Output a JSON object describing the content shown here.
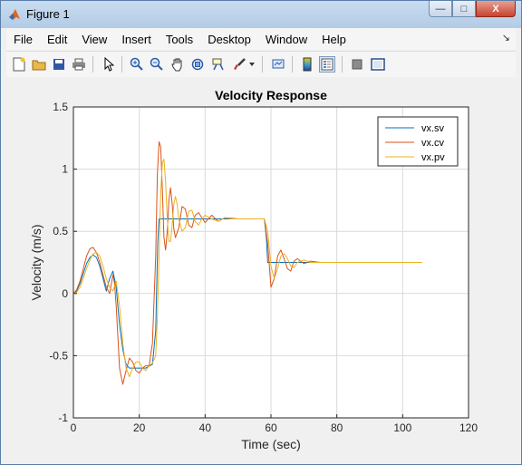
{
  "window": {
    "title": "Figure 1",
    "controls": {
      "minimize": "—",
      "maximize": "□",
      "close": "X"
    }
  },
  "menubar": {
    "items": [
      "File",
      "Edit",
      "View",
      "Insert",
      "Tools",
      "Desktop",
      "Window",
      "Help"
    ]
  },
  "toolbar": {
    "icons": [
      "new-figure-icon",
      "open-file-icon",
      "save-icon",
      "print-icon",
      "pointer-icon",
      "zoom-in-icon",
      "zoom-out-icon",
      "pan-hand-icon",
      "rotate-3d-icon",
      "data-cursor-icon",
      "brush-icon",
      "brush-dropdown-icon",
      "link-plot-icon",
      "insert-colorbar-icon",
      "insert-legend-icon",
      "hide-plot-tools-icon",
      "show-plot-tools-icon"
    ]
  },
  "colors": {
    "sv": "#0072bd",
    "cv": "#d95319",
    "pv": "#edb120",
    "grid": "#d9d9d9"
  },
  "chart_data": {
    "type": "line",
    "title": "Velocity Response",
    "xlabel": "Time (sec)",
    "ylabel": "Velocity (m/s)",
    "xlim": [
      0,
      120
    ],
    "ylim": [
      -1,
      1.5
    ],
    "xticks": [
      0,
      20,
      40,
      60,
      80,
      100,
      120
    ],
    "yticks": [
      -1,
      -0.5,
      0,
      0.5,
      1,
      1.5
    ],
    "grid": true,
    "legend_position": "top-right",
    "series": [
      {
        "name": "vx.sv",
        "color": "#0072bd",
        "x": [
          0,
          1,
          2,
          3,
          4,
          5,
          6,
          7,
          8,
          9,
          10,
          11,
          12,
          13,
          14,
          15,
          16,
          17,
          18,
          20,
          22,
          24,
          25,
          25.6,
          26,
          30,
          40,
          50,
          58,
          58.6,
          59,
          60,
          70,
          80,
          90,
          100
        ],
        "y": [
          0,
          0.02,
          0.08,
          0.16,
          0.24,
          0.29,
          0.31,
          0.29,
          0.22,
          0.12,
          0.02,
          0.12,
          0.18,
          0.05,
          -0.25,
          -0.45,
          -0.57,
          -0.6,
          -0.6,
          -0.6,
          -0.6,
          -0.57,
          -0.3,
          0.4,
          0.6,
          0.6,
          0.6,
          0.6,
          0.6,
          0.45,
          0.25,
          0.25,
          0.25,
          0.25,
          0.25,
          0.25
        ]
      },
      {
        "name": "vx.cv",
        "color": "#d95319",
        "x": [
          0,
          1,
          2,
          3,
          4,
          5,
          6,
          7,
          8,
          9,
          10,
          11,
          12,
          12.5,
          13,
          13.5,
          14,
          15,
          16,
          17,
          18,
          19,
          20,
          21,
          22,
          23,
          24,
          25,
          25.5,
          26,
          26.5,
          27,
          27.5,
          28,
          28.5,
          29,
          29.5,
          30,
          30.5,
          31,
          32,
          33,
          34,
          35,
          36,
          37,
          38,
          40,
          42,
          44,
          46,
          50,
          55,
          58,
          59,
          60,
          61,
          62,
          63,
          64,
          65,
          66,
          67,
          68,
          70,
          72,
          75,
          80,
          88
        ],
        "y": [
          0,
          0.03,
          0.1,
          0.2,
          0.3,
          0.36,
          0.37,
          0.33,
          0.25,
          0.15,
          0.05,
          0.0,
          0.15,
          0.08,
          -0.1,
          -0.35,
          -0.6,
          -0.73,
          -0.62,
          -0.52,
          -0.55,
          -0.62,
          -0.64,
          -0.6,
          -0.58,
          -0.58,
          -0.4,
          0.3,
          0.95,
          1.22,
          1.18,
          0.85,
          0.45,
          0.35,
          0.5,
          0.75,
          0.85,
          0.72,
          0.52,
          0.45,
          0.53,
          0.7,
          0.68,
          0.55,
          0.53,
          0.63,
          0.65,
          0.57,
          0.63,
          0.58,
          0.61,
          0.6,
          0.6,
          0.6,
          0.4,
          0.05,
          0.12,
          0.3,
          0.35,
          0.28,
          0.2,
          0.18,
          0.26,
          0.28,
          0.24,
          0.26,
          0.25,
          0.25,
          0.25
        ]
      },
      {
        "name": "vx.pv",
        "color": "#edb120",
        "x": [
          0,
          1,
          2,
          3,
          4,
          5,
          6,
          7,
          8,
          9,
          10,
          11,
          12,
          13,
          14,
          15,
          16,
          17,
          18,
          19,
          20,
          21,
          22,
          23,
          24,
          25,
          25.5,
          26,
          26.5,
          27,
          27.5,
          28,
          28.5,
          29,
          29.5,
          30,
          30.5,
          31,
          31.5,
          32,
          33,
          34,
          35,
          36,
          37,
          38,
          39,
          40,
          42,
          44,
          46,
          48,
          50,
          55,
          58,
          59,
          60,
          61,
          62,
          63,
          64,
          65,
          66,
          67,
          68,
          70,
          72,
          75,
          80,
          90,
          100,
          106
        ],
        "y": [
          0,
          0.01,
          0.05,
          0.12,
          0.2,
          0.27,
          0.32,
          0.33,
          0.3,
          0.22,
          0.12,
          0.05,
          0.02,
          0.1,
          -0.1,
          -0.4,
          -0.6,
          -0.67,
          -0.6,
          -0.55,
          -0.55,
          -0.6,
          -0.62,
          -0.58,
          -0.56,
          -0.5,
          -0.2,
          0.3,
          0.8,
          1.05,
          1.08,
          0.9,
          0.6,
          0.42,
          0.42,
          0.55,
          0.72,
          0.78,
          0.72,
          0.6,
          0.5,
          0.53,
          0.66,
          0.67,
          0.58,
          0.55,
          0.6,
          0.63,
          0.6,
          0.58,
          0.61,
          0.6,
          0.6,
          0.6,
          0.6,
          0.5,
          0.22,
          0.12,
          0.2,
          0.3,
          0.32,
          0.28,
          0.22,
          0.21,
          0.25,
          0.27,
          0.25,
          0.25,
          0.25,
          0.25,
          0.25,
          0.25
        ]
      }
    ]
  }
}
